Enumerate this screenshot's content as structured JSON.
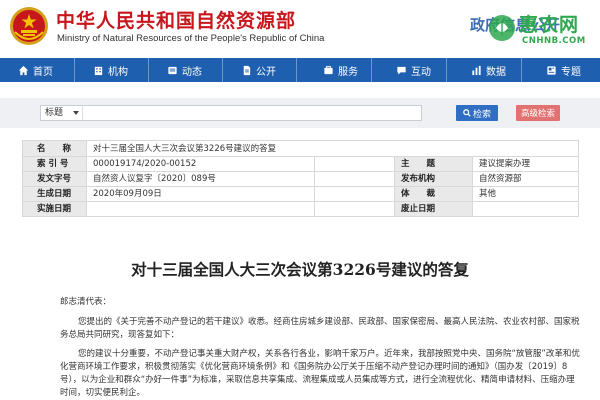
{
  "header": {
    "site_title": "中华人民共和国自然资源部",
    "site_subtitle": "Ministry of Natural Resources of the People's Republic of China",
    "gov_info": "政府信息公开",
    "watermark_text": "惠农网",
    "watermark_domain": "CNHNB.COM",
    "colors": {
      "title_red": "#c8161d",
      "nav_blue": "#1f5fb0",
      "watermark_green": "#2fa84f"
    }
  },
  "nav": {
    "items": [
      {
        "label": "首页",
        "icon": "home-icon"
      },
      {
        "label": "机构",
        "icon": "building-icon"
      },
      {
        "label": "动态",
        "icon": "news-icon"
      },
      {
        "label": "公开",
        "icon": "document-icon"
      },
      {
        "label": "服务",
        "icon": "service-icon"
      },
      {
        "label": "互动",
        "icon": "chat-icon"
      },
      {
        "label": "数据",
        "icon": "chart-icon"
      },
      {
        "label": "专题",
        "icon": "topic-icon"
      }
    ]
  },
  "search": {
    "scope": "标题",
    "input_value": "",
    "search_label": "检索",
    "advanced_label": "高级检索"
  },
  "meta": {
    "name_label": "名　　称",
    "name_value": "对十三届全国人大三次会议第3226号建议的答复",
    "index_label": "索 引 号",
    "index_value": "000019174/2020-00152",
    "topic_label": "主　　题",
    "topic_value": "建议提案办理",
    "doc_no_label": "发文字号",
    "doc_no_value": "自然资人议复字〔2020〕089号",
    "issuer_label": "发布机构",
    "issuer_value": "自然资源部",
    "gen_date_label": "生成日期",
    "gen_date_value": "2020年09月09日",
    "carrier_label": "体　　裁",
    "carrier_value": "其他",
    "impl_date_label": "实施日期",
    "impl_date_value": "",
    "expire_date_label": "废止日期",
    "expire_date_value": ""
  },
  "article": {
    "title": "对十三届全国人大三次会议第3226号建议的答复",
    "greeting": "郎志清代表：",
    "para1": "您提出的《关于完善不动产登记的若干建议》收悉。经商住房城乡建设部、民政部、国家保密局、最高人民法院、农业农村部、国家税务总局共同研究，现答复如下：",
    "para2": "您的建议十分重要，不动产登记事关重大财产权，关系各行各业，影响千家万户。近年来，我部按照党中央、国务院“放管服”改革和优化营商环境工作要求，积极贯彻落实《优化营商环境条例》和《国务院办公厅关于压缩不动产登记办理时间的通知》（国办发〔2019〕8号），以为企业和群众“办好一件事”为标准，采取信息共享集成、流程集成或人员集成等方式，进行全流程优化、精简申请材料、压缩办理时间，切实便民利企。"
  }
}
